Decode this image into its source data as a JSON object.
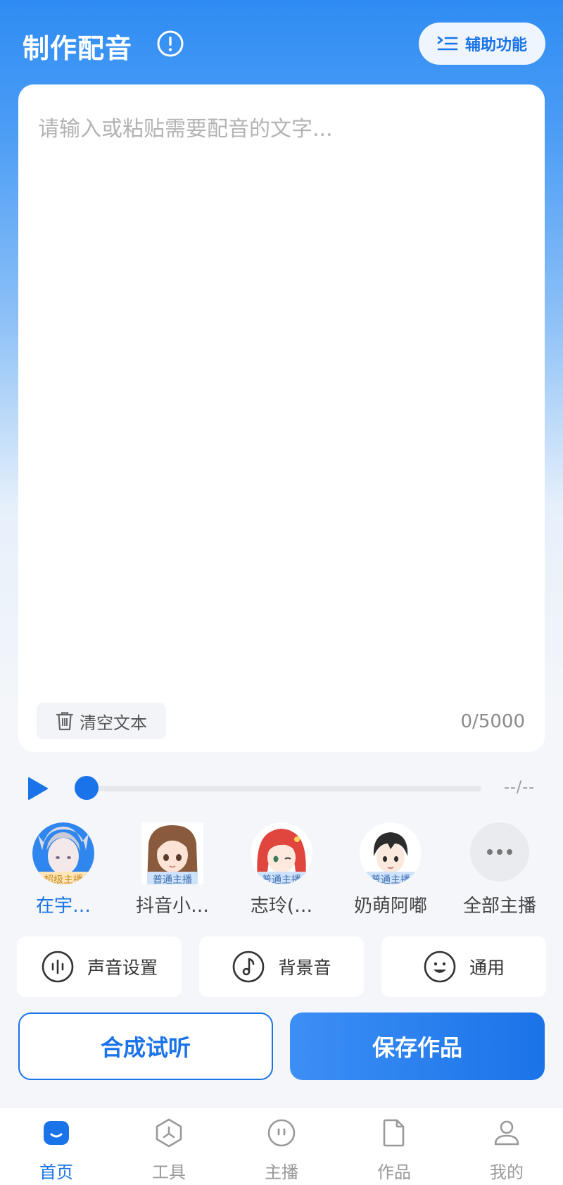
{
  "header": {
    "title": "制作配音",
    "assist_label": "辅助功能"
  },
  "editor": {
    "placeholder": "请输入或粘贴需要配音的文字...",
    "clear_label": "清空文本",
    "counter": "0/5000"
  },
  "player": {
    "time": "--/--",
    "progress": 0
  },
  "anchors": [
    {
      "name": "在宇…",
      "badge": "超级主播",
      "selected": true
    },
    {
      "name": "抖音小…",
      "badge": "普通主播",
      "selected": false
    },
    {
      "name": "志玲(…",
      "badge": "普通主播",
      "selected": false
    },
    {
      "name": "奶萌阿嘟",
      "badge": "普通主播",
      "selected": false
    }
  ],
  "all_anchors_label": "全部主播",
  "settings": {
    "voice": "声音设置",
    "bgm": "背景音",
    "general": "通用"
  },
  "actions": {
    "preview": "合成试听",
    "save": "保存作品"
  },
  "tabs": [
    {
      "label": "首页",
      "icon": "home-icon",
      "active": true
    },
    {
      "label": "工具",
      "icon": "tools-icon",
      "active": false
    },
    {
      "label": "主播",
      "icon": "anchor-icon",
      "active": false
    },
    {
      "label": "作品",
      "icon": "works-icon",
      "active": false
    },
    {
      "label": "我的",
      "icon": "profile-icon",
      "active": false
    }
  ],
  "colors": {
    "accent": "#1a73e8",
    "super_badge": "#ffe6b8",
    "normal_badge": "#cfe2fb"
  }
}
